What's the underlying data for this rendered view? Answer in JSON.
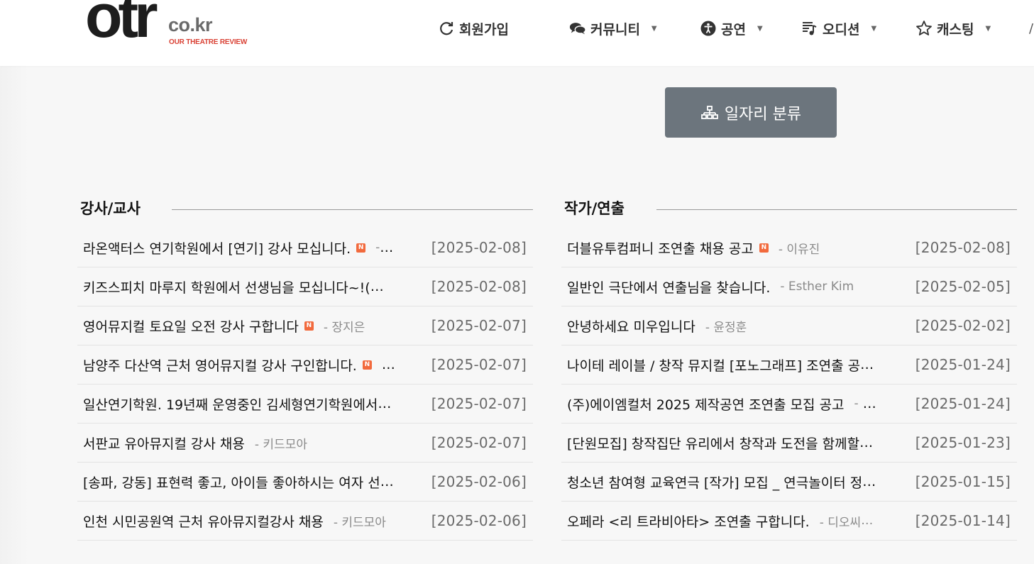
{
  "header": {
    "logo": {
      "main": "otr",
      "domain": "co.kr",
      "tagline": "OUR THEATRE REVIEW"
    },
    "nav": [
      {
        "label": "회원가입",
        "icon": "refresh-icon",
        "has_caret": false
      },
      {
        "label": "커뮤니티",
        "icon": "comments-icon",
        "has_caret": true
      },
      {
        "label": "공연",
        "icon": "accessibility-icon",
        "has_caret": true
      },
      {
        "label": "오디션",
        "icon": "playlist-icon",
        "has_caret": true
      },
      {
        "label": "캐스팅",
        "icon": "star-icon",
        "has_caret": true
      }
    ],
    "nav_more": "/",
    "caret": "▼"
  },
  "category_button": {
    "label": "일자리 분류",
    "icon": "sitemap-icon"
  },
  "new_badge": "N",
  "ellipsis": "…",
  "sections": [
    {
      "title": "강사/교사",
      "rows": [
        {
          "title": "라온액터스 연기학원에서 [연기] 강사 모십니다.",
          "new": true,
          "author": "-",
          "date": "[2025-02-08]"
        },
        {
          "title": "키즈스피치 마루지 학원에서 선생님을 모십니다~!(",
          "new": false,
          "author": "",
          "date": "[2025-02-08]"
        },
        {
          "title": "영어뮤지컬 토요일 오전 강사 구합니다",
          "new": true,
          "author": "- 장지은",
          "date": "[2025-02-07]"
        },
        {
          "title": "남양주 다산역 근처 영어뮤지컬 강사 구인합니다.",
          "new": true,
          "author": "",
          "date": "[2025-02-07]"
        },
        {
          "title": "일산연기학원. 19년째 운영중인 김세형연기학원에서",
          "new": false,
          "author": "",
          "date": "[2025-02-07]"
        },
        {
          "title": "서판교 유아뮤지컬 강사 채용",
          "new": false,
          "author": "- 키드모아",
          "date": "[2025-02-07]"
        },
        {
          "title": "[송파, 강동] 표현력 좋고, 아이들 좋아하시는 여자 선",
          "new": false,
          "author": "",
          "date": "[2025-02-06]"
        },
        {
          "title": "인천 시민공원역 근처 유아뮤지컬강사 채용",
          "new": false,
          "author": "- 키드모아",
          "date": "[2025-02-06]"
        }
      ]
    },
    {
      "title": "작가/연출",
      "rows": [
        {
          "title": "더블유투컴퍼니 조연출 채용 공고",
          "new": true,
          "author": "- 이유진",
          "date": "[2025-02-08]"
        },
        {
          "title": "일반인 극단에서 연출님을 찾습니다.",
          "new": false,
          "author": "- Esther Kim",
          "date": "[2025-02-05]"
        },
        {
          "title": "안녕하세요 미우입니다",
          "new": false,
          "author": "- 윤정훈",
          "date": "[2025-02-02]"
        },
        {
          "title": "나이테 레이블 / 창작 뮤지컬 [포노그래프] 조연출 공",
          "new": false,
          "author": "",
          "date": "[2025-01-24]"
        },
        {
          "title": "(주)에이엠컬처 2025 제작공연 조연출 모집 공고",
          "new": false,
          "author": "-",
          "date": "[2025-01-24]"
        },
        {
          "title": "[단원모집] 창작집단 유리에서 창작과 도전을 함께할",
          "new": false,
          "author": "",
          "date": "[2025-01-23]"
        },
        {
          "title": "청소년 참여형 교육연극 [작가] 모집 _ 연극놀이터 정",
          "new": false,
          "author": "",
          "date": "[2025-01-15]"
        },
        {
          "title": "오페라 <리 트라비아타> 조연출 구합니다.",
          "new": false,
          "author": "- 디오씨",
          "date": "[2025-01-14]"
        }
      ]
    }
  ]
}
